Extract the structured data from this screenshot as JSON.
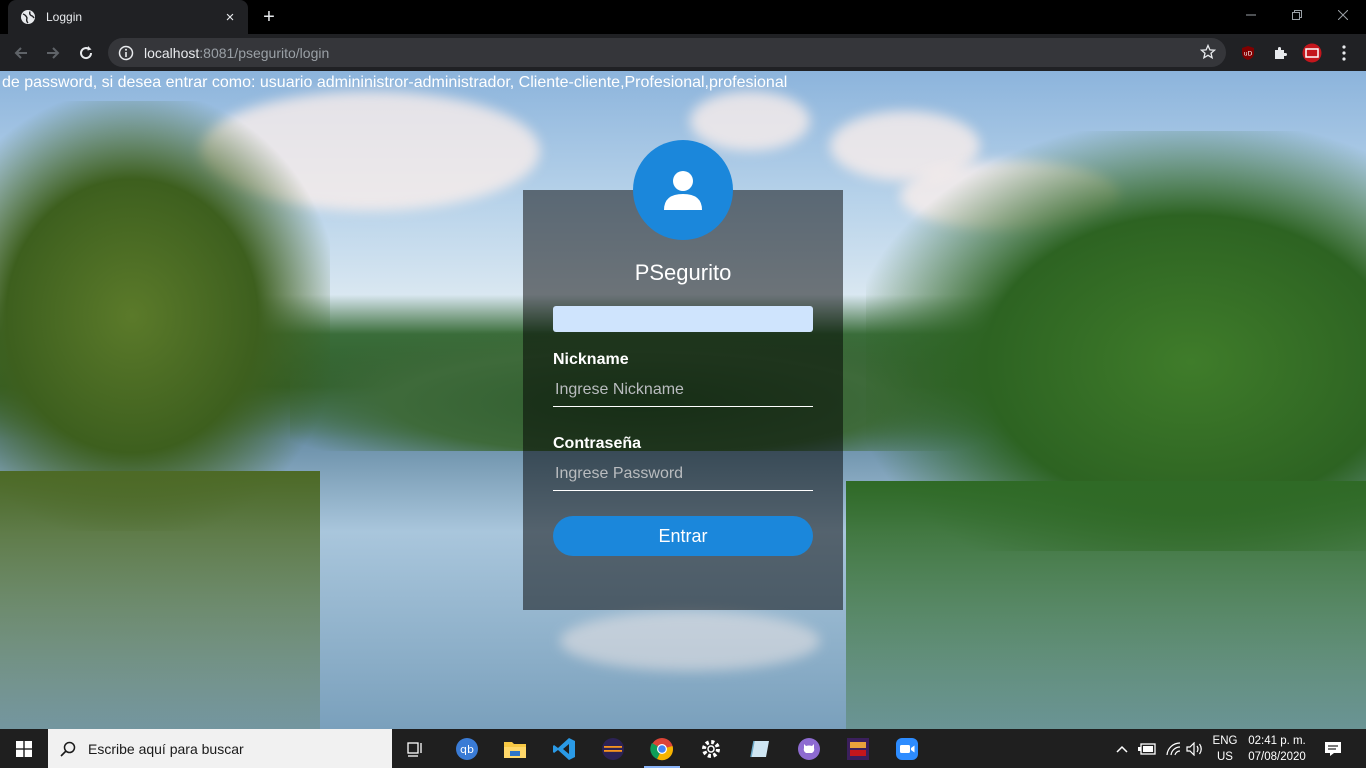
{
  "browser": {
    "tab_title": "Loggin",
    "tab_close": "×",
    "new_tab": "+",
    "url_host": "localhost",
    "url_rest": ":8081/psegurito/login"
  },
  "page": {
    "notice": "de password, si desea entrar como: usuario admininistror-administrador, Cliente-cliente,Profesional,profesional",
    "brand": "PSegurito",
    "nickname_label": "Nickname",
    "nickname_placeholder": "Ingrese Nickname",
    "password_label": "Contraseña",
    "password_placeholder": "Ingrese Password",
    "submit_label": "Entrar",
    "accent_color": "#1b87db"
  },
  "taskbar": {
    "search_placeholder": "Escribe aquí para buscar",
    "language_line1": "ENG",
    "language_line2": "US",
    "time": "02:41 p. m.",
    "date": "07/08/2020"
  }
}
